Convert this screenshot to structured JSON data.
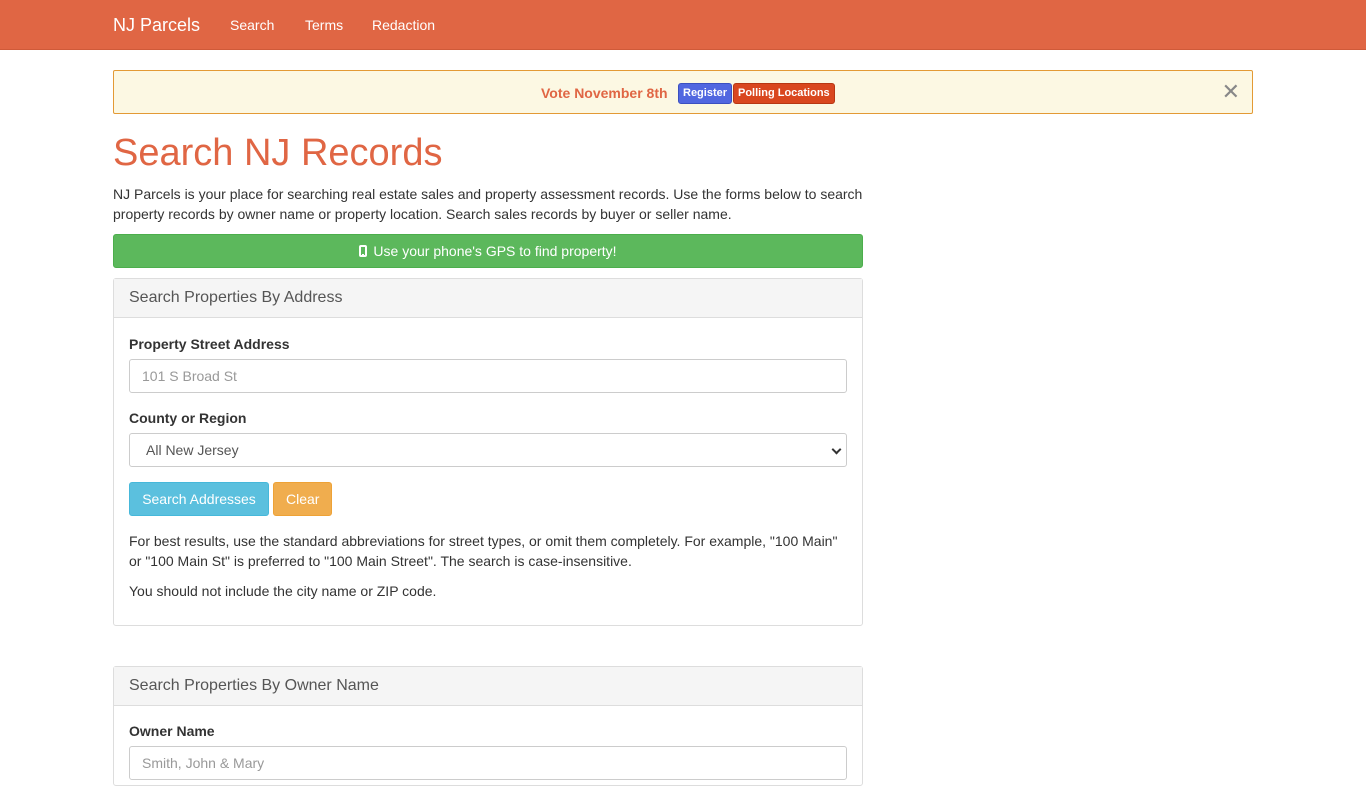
{
  "navbar": {
    "brand": "NJ Parcels",
    "links": [
      "Search",
      "Terms",
      "Redaction"
    ]
  },
  "alert": {
    "text": "Vote November 8th",
    "register_label": "Register",
    "polling_label": "Polling Locations",
    "close_glyph": "✕"
  },
  "page": {
    "title": "Search NJ Records",
    "intro": "NJ Parcels is your place for searching real estate sales and property assessment records. Use the forms below to search property records by owner name or property location. Search sales records by buyer or seller name.",
    "gps_button": "Use your phone's GPS to find property!"
  },
  "address_panel": {
    "heading": "Search Properties By Address",
    "street_label": "Property Street Address",
    "street_placeholder": "101 S Broad St",
    "county_label": "County or Region",
    "county_selected": "All New Jersey",
    "search_button": "Search Addresses",
    "clear_button": "Clear",
    "help_1": "For best results, use the standard abbreviations for street types, or omit them completely. For example, \"100 Main\" or \"100 Main St\" is preferred to \"100 Main Street\". The search is case-insensitive.",
    "help_2": "You should not include the city name or ZIP code."
  },
  "owner_panel": {
    "heading": "Search Properties By Owner Name",
    "owner_label": "Owner Name",
    "owner_placeholder": "Smith, John & Mary"
  },
  "colors": {
    "brand": "#e06644",
    "success": "#5cb85c",
    "info": "#5bc0de",
    "warning": "#f0ad4e",
    "alert_bg": "#fcf8e3"
  }
}
